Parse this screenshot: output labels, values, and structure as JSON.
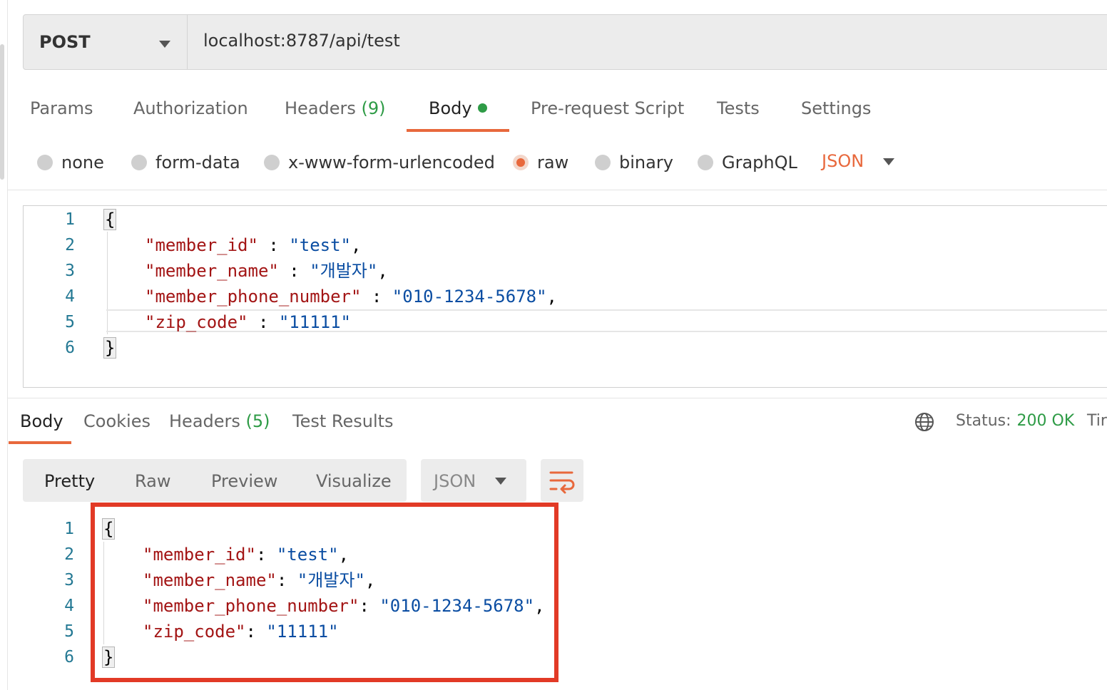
{
  "request": {
    "method": "POST",
    "url": "localhost:8787/api/test",
    "tabs": [
      {
        "label": "Params"
      },
      {
        "label": "Authorization"
      },
      {
        "label": "Headers",
        "count": "(9)"
      },
      {
        "label": "Body",
        "active": true
      },
      {
        "label": "Pre-request Script"
      },
      {
        "label": "Tests"
      },
      {
        "label": "Settings"
      }
    ],
    "body_types": [
      "none",
      "form-data",
      "x-www-form-urlencoded",
      "raw",
      "binary",
      "GraphQL"
    ],
    "selected_body_type": "raw",
    "format": "JSON",
    "code": {
      "line_numbers": [
        "1",
        "2",
        "3",
        "4",
        "5",
        "6"
      ],
      "open_brace": "{",
      "close_brace": "}",
      "fields": [
        {
          "key": "\"member_id\"",
          "sep": " : ",
          "value": "\"test\"",
          "trail": ","
        },
        {
          "key": "\"member_name\"",
          "sep": " : ",
          "value": "\"개발자\"",
          "trail": ","
        },
        {
          "key": "\"member_phone_number\"",
          "sep": " : ",
          "value": "\"010-1234-5678\"",
          "trail": ","
        },
        {
          "key": "\"zip_code\"",
          "sep": " : ",
          "value": "\"11111\"",
          "trail": ""
        }
      ]
    }
  },
  "response": {
    "tabs": [
      {
        "label": "Body",
        "active": true
      },
      {
        "label": "Cookies"
      },
      {
        "label": "Headers",
        "count": "(5)"
      },
      {
        "label": "Test Results"
      }
    ],
    "status_label": "Status:",
    "status_value": "200 OK",
    "time_label_cut": "Tir",
    "views": [
      "Pretty",
      "Raw",
      "Preview",
      "Visualize"
    ],
    "active_view": "Pretty",
    "format": "JSON",
    "code": {
      "line_numbers": [
        "1",
        "2",
        "3",
        "4",
        "5",
        "6"
      ],
      "open_brace": "{",
      "close_brace": "}",
      "fields": [
        {
          "key": "\"member_id\"",
          "sep": ": ",
          "value": "\"test\"",
          "trail": ","
        },
        {
          "key": "\"member_name\"",
          "sep": ": ",
          "value": "\"개발자\"",
          "trail": ","
        },
        {
          "key": "\"member_phone_number\"",
          "sep": ": ",
          "value": "\"010-1234-5678\"",
          "trail": ","
        },
        {
          "key": "\"zip_code\"",
          "sep": ": ",
          "value": "\"11111\"",
          "trail": ""
        }
      ]
    }
  },
  "colors": {
    "accent": "#e8683c",
    "success": "#2e9b46",
    "json_key": "#a31515",
    "json_string": "#0a4da2",
    "highlight_box": "#e23a26"
  },
  "icons": {
    "method_dropdown": "chevron-down-icon",
    "format_dropdown": "chevron-down-icon",
    "globe": "globe-icon",
    "wrap": "wrap-lines-icon"
  }
}
